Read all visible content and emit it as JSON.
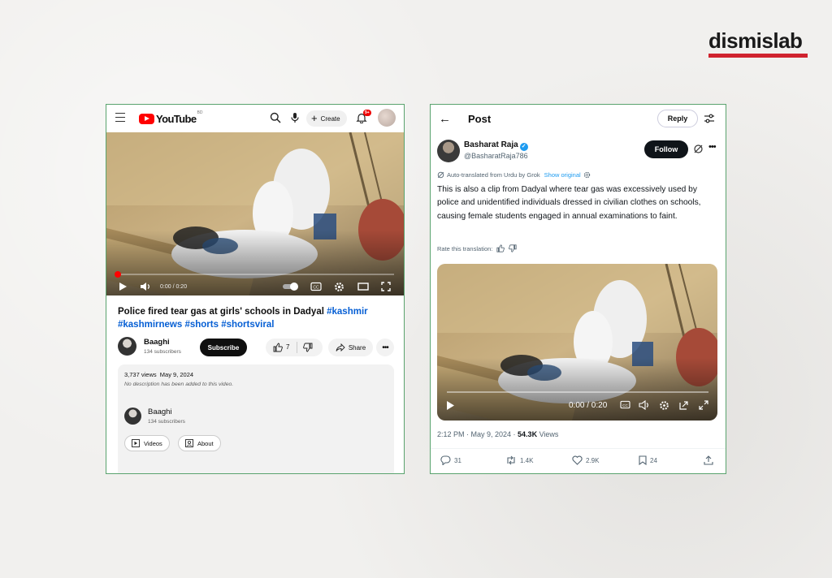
{
  "brand": {
    "name": "dismislab",
    "accent": "#d0232e"
  },
  "youtube": {
    "logo_text": "YouTube",
    "logo_superscript": "BD",
    "create_label": "Create",
    "notif_badge": "9+",
    "video_time": "0:00 / 0:20",
    "title_text": "Police fired tear gas at girls' schools in Dadyal",
    "hashtags": [
      "#kashmir",
      "#kashmirnews",
      "#shorts",
      "#shortsviral"
    ],
    "channel": {
      "name": "Baaghi",
      "subscribers": "134 subscribers"
    },
    "subscribe_label": "Subscribe",
    "like_count": "7",
    "share_label": "Share",
    "description": {
      "views": "3,737 views",
      "date": "May 9, 2024",
      "empty_text": "No description has been added to this video."
    },
    "tabs": {
      "videos": "Videos",
      "about": "About"
    },
    "icons": [
      "menu-icon",
      "search-icon",
      "mic-icon",
      "plus-icon",
      "bell-icon",
      "play-icon",
      "volume-icon",
      "settings-icon",
      "theater-icon",
      "fullscreen-icon",
      "thumbs-up-icon",
      "thumbs-down-icon",
      "share-icon",
      "more-icon"
    ]
  },
  "twitter": {
    "header_title": "Post",
    "reply_label": "Reply",
    "user": {
      "name": "Basharat Raja",
      "handle": "@BasharatRaja786"
    },
    "follow_label": "Follow",
    "translation_note": "Auto-translated from Urdu by Grok",
    "show_original": "Show original",
    "post_text": "This is also a clip from Dadyal where tear gas was excessively used by police and unidentified individuals dressed in civilian clothes on schools, causing female students engaged in annual examinations to faint.",
    "rate_translation": "Rate this translation:",
    "video_time": "0:00 / 0:20",
    "timestamp": "2:12 PM · May 9, 2024 · ",
    "views_count": "54.3K",
    "views_label": " Views",
    "actions": {
      "replies": "31",
      "reposts": "1.4K",
      "likes": "2.9K",
      "bookmarks": "24"
    },
    "colors": {
      "verified": "#1d9bf0",
      "follow_bg": "#0f1419"
    }
  }
}
